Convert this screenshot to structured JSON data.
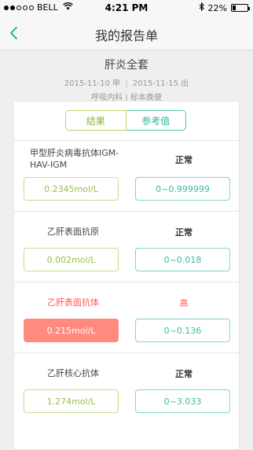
{
  "status_bar": {
    "carrier": "BELL",
    "time": "4:21 PM",
    "battery_percent": "22%",
    "battery_level": 0.22,
    "signal_bars_filled": 2,
    "signal_bars_total": 5
  },
  "nav": {
    "title": "我的报告单",
    "back_icon": "chevron-left-icon"
  },
  "report": {
    "name": "肝炎全套",
    "apply_date": "2015-11-10 申",
    "issue_date": "2015-11-15 出",
    "separator": "|",
    "department": "呼吸内科",
    "sample": "标本粪便"
  },
  "tabs": {
    "result": "结果",
    "reference": "参考值"
  },
  "items": [
    {
      "name": "甲型肝炎病毒抗体IGM-HAV-IGM",
      "status": "正常",
      "value": "0.2345mol/L",
      "range": "0~0.999999"
    },
    {
      "name": "乙肝表面抗原",
      "status": "正常",
      "value": "0.002mol/L",
      "range": "0~0.018"
    },
    {
      "name": "乙肝表面抗体",
      "status": "高",
      "value": "0.215mol/L",
      "range": "0~0.136"
    },
    {
      "name": "乙肝核心抗体",
      "status": "正常",
      "value": "1.274mol/L",
      "range": "0~3.033"
    }
  ],
  "colors": {
    "accent_teal": "#2fb79a",
    "accent_green": "#8db33a",
    "abnormal_red": "#ff5a4f"
  }
}
